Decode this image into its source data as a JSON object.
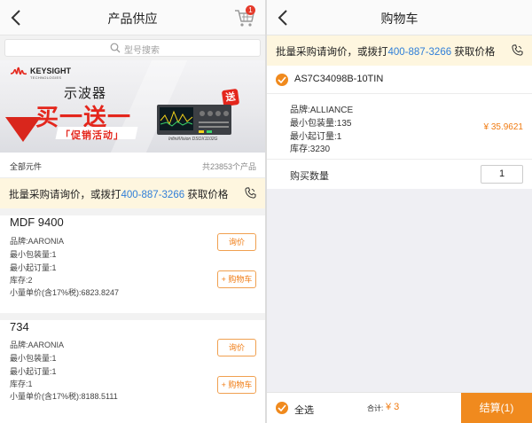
{
  "left": {
    "header": {
      "title": "产品供应",
      "cart_badge": "1"
    },
    "search": {
      "placeholder": "型号搜索"
    },
    "banner": {
      "brand": "KEYSIGHT",
      "brand_sub": "TECHNOLOGIES",
      "heading": "示波器",
      "promo": "买一送一",
      "promo_sub": "「促销活动」",
      "gift_badge": "送",
      "model": "InfiniiVision DSOX1102G"
    },
    "list_header": {
      "label": "全部元件",
      "count": "共23853个产品"
    },
    "notice": {
      "prefix": "批量采购请询价，或拨打",
      "phone": "400-887-3266",
      "suffix": "获取价格"
    },
    "products": [
      {
        "name": "MDF 9400",
        "brand": "品牌:AARONIA",
        "min_pack": "最小包装量:1",
        "min_order": "最小起订量:1",
        "stock": "库存:2",
        "unit_price": "小量单价(含17%税):6823.8247",
        "inquiry_label": "询价",
        "cart_label": "+ 购物车"
      },
      {
        "name": "734",
        "brand": "品牌:AARONIA",
        "min_pack": "最小包装量:1",
        "min_order": "最小起订量:1",
        "stock": "库存:1",
        "unit_price": "小量单价(含17%税):8188.5111",
        "inquiry_label": "询价",
        "cart_label": "+ 购物车"
      }
    ]
  },
  "right": {
    "header": {
      "title": "购物车"
    },
    "notice": {
      "prefix": "批量采购请询价，或拨打",
      "phone": "400-887-3266",
      "suffix": "获取价格"
    },
    "item": {
      "part_number": "AS7C34098B-10TIN",
      "brand": "品牌:ALLIANCE",
      "min_pack": "最小包装量:135",
      "min_order": "最小起订量:1",
      "stock": "库存:3230",
      "price": "¥ 35.9621"
    },
    "quantity": {
      "label": "购买数量",
      "value": "1"
    },
    "footer": {
      "select_all": "全选",
      "total_label": "合计:",
      "total_value": "¥ 3",
      "checkout": "结算(1)"
    }
  },
  "colors": {
    "accent": "#f08a1e",
    "price": "#f07b12",
    "phone": "#2f7ed8",
    "notice_bg": "#fef6df",
    "badge": "#e53b2c"
  },
  "icons": [
    "back-arrow-icon",
    "cart-icon",
    "search-icon",
    "phone-icon",
    "check-circle-icon"
  ]
}
